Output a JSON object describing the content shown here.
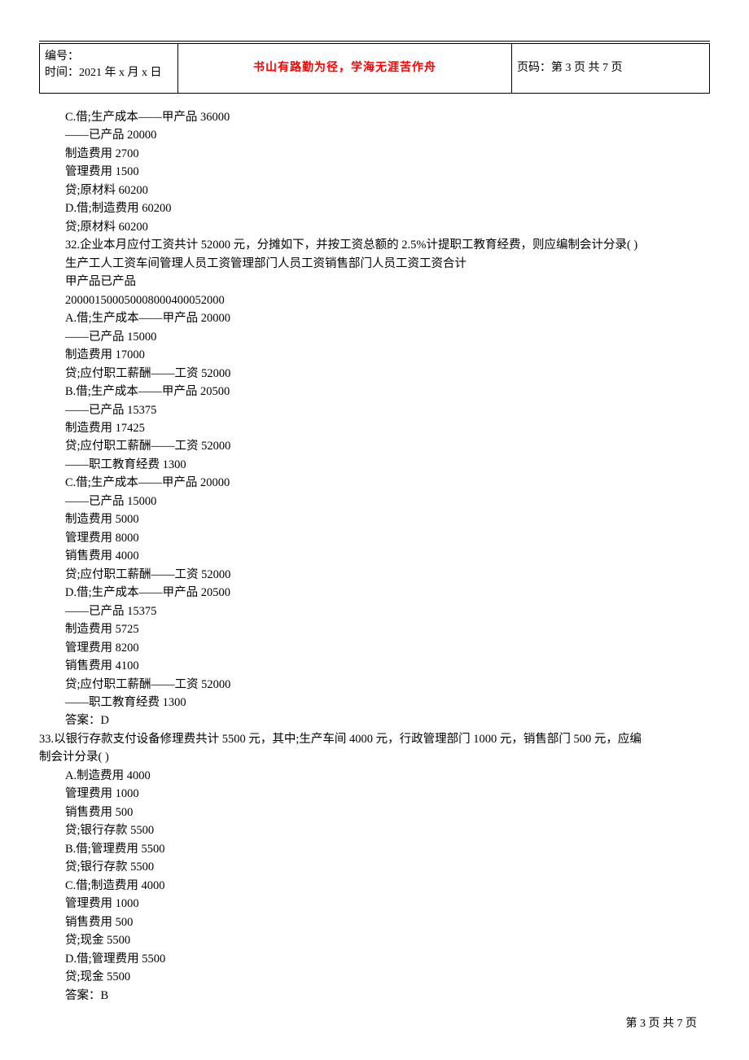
{
  "header": {
    "id_label": "编号：",
    "time_label": "时间：2021 年 x 月 x 日",
    "motto": "书山有路勤为径，学海无涯苦作舟",
    "page_label": "页码：第 3 页 共 7 页"
  },
  "body": {
    "lines_indent_1": [
      "C.借;生产成本——甲产品 36000",
      "——已产品 20000",
      "制造费用 2700",
      "管理费用 1500",
      "贷;原材料 60200",
      "D.借;制造费用 60200",
      "贷;原材料 60200",
      "32.企业本月应付工资共计 52000 元，分摊如下，并按工资总额的 2.5%计提职工教育经费，则应编制会计分录( )",
      "生产工人工资车间管理人员工资管理部门人员工资销售部门人员工资工资合计",
      "甲产品已产品",
      "200001500050008000400052000",
      "A.借;生产成本——甲产品 20000",
      "——已产品 15000",
      "制造费用 17000",
      "贷;应付职工薪酬——工资 52000",
      "B.借;生产成本——甲产品 20500",
      "——已产品 15375",
      "制造费用 17425",
      "贷;应付职工薪酬——工资 52000",
      "——职工教育经费 1300",
      "C.借;生产成本——甲产品 20000",
      "——已产品 15000",
      "制造费用 5000",
      "管理费用 8000",
      "销售费用 4000",
      "贷;应付职工薪酬——工资 52000",
      "D.借;生产成本——甲产品 20500",
      "——已产品 15375",
      "制造费用 5725",
      "管理费用 8200",
      "销售费用 4100",
      "贷;应付职工薪酬——工资 52000",
      "——职工教育经费 1300",
      "答案：D"
    ],
    "lines_noindent": [
      "33.以银行存款支付设备修理费共计 5500 元，其中;生产车间 4000 元，行政管理部门 1000 元，销售部门 500 元，应编",
      "制会计分录( )"
    ],
    "lines_indent_2": [
      "A.制造费用 4000",
      "管理费用 1000",
      "销售费用 500",
      "贷;银行存款 5500",
      "B.借;管理费用 5500",
      "贷;银行存款 5500",
      "C.借;制造费用 4000",
      "管理费用 1000",
      "销售费用 500",
      "贷;现金 5500",
      "D.借;管理费用 5500",
      "贷;现金 5500",
      "答案：B"
    ]
  },
  "footer": {
    "text": "第 3 页 共 7 页"
  }
}
